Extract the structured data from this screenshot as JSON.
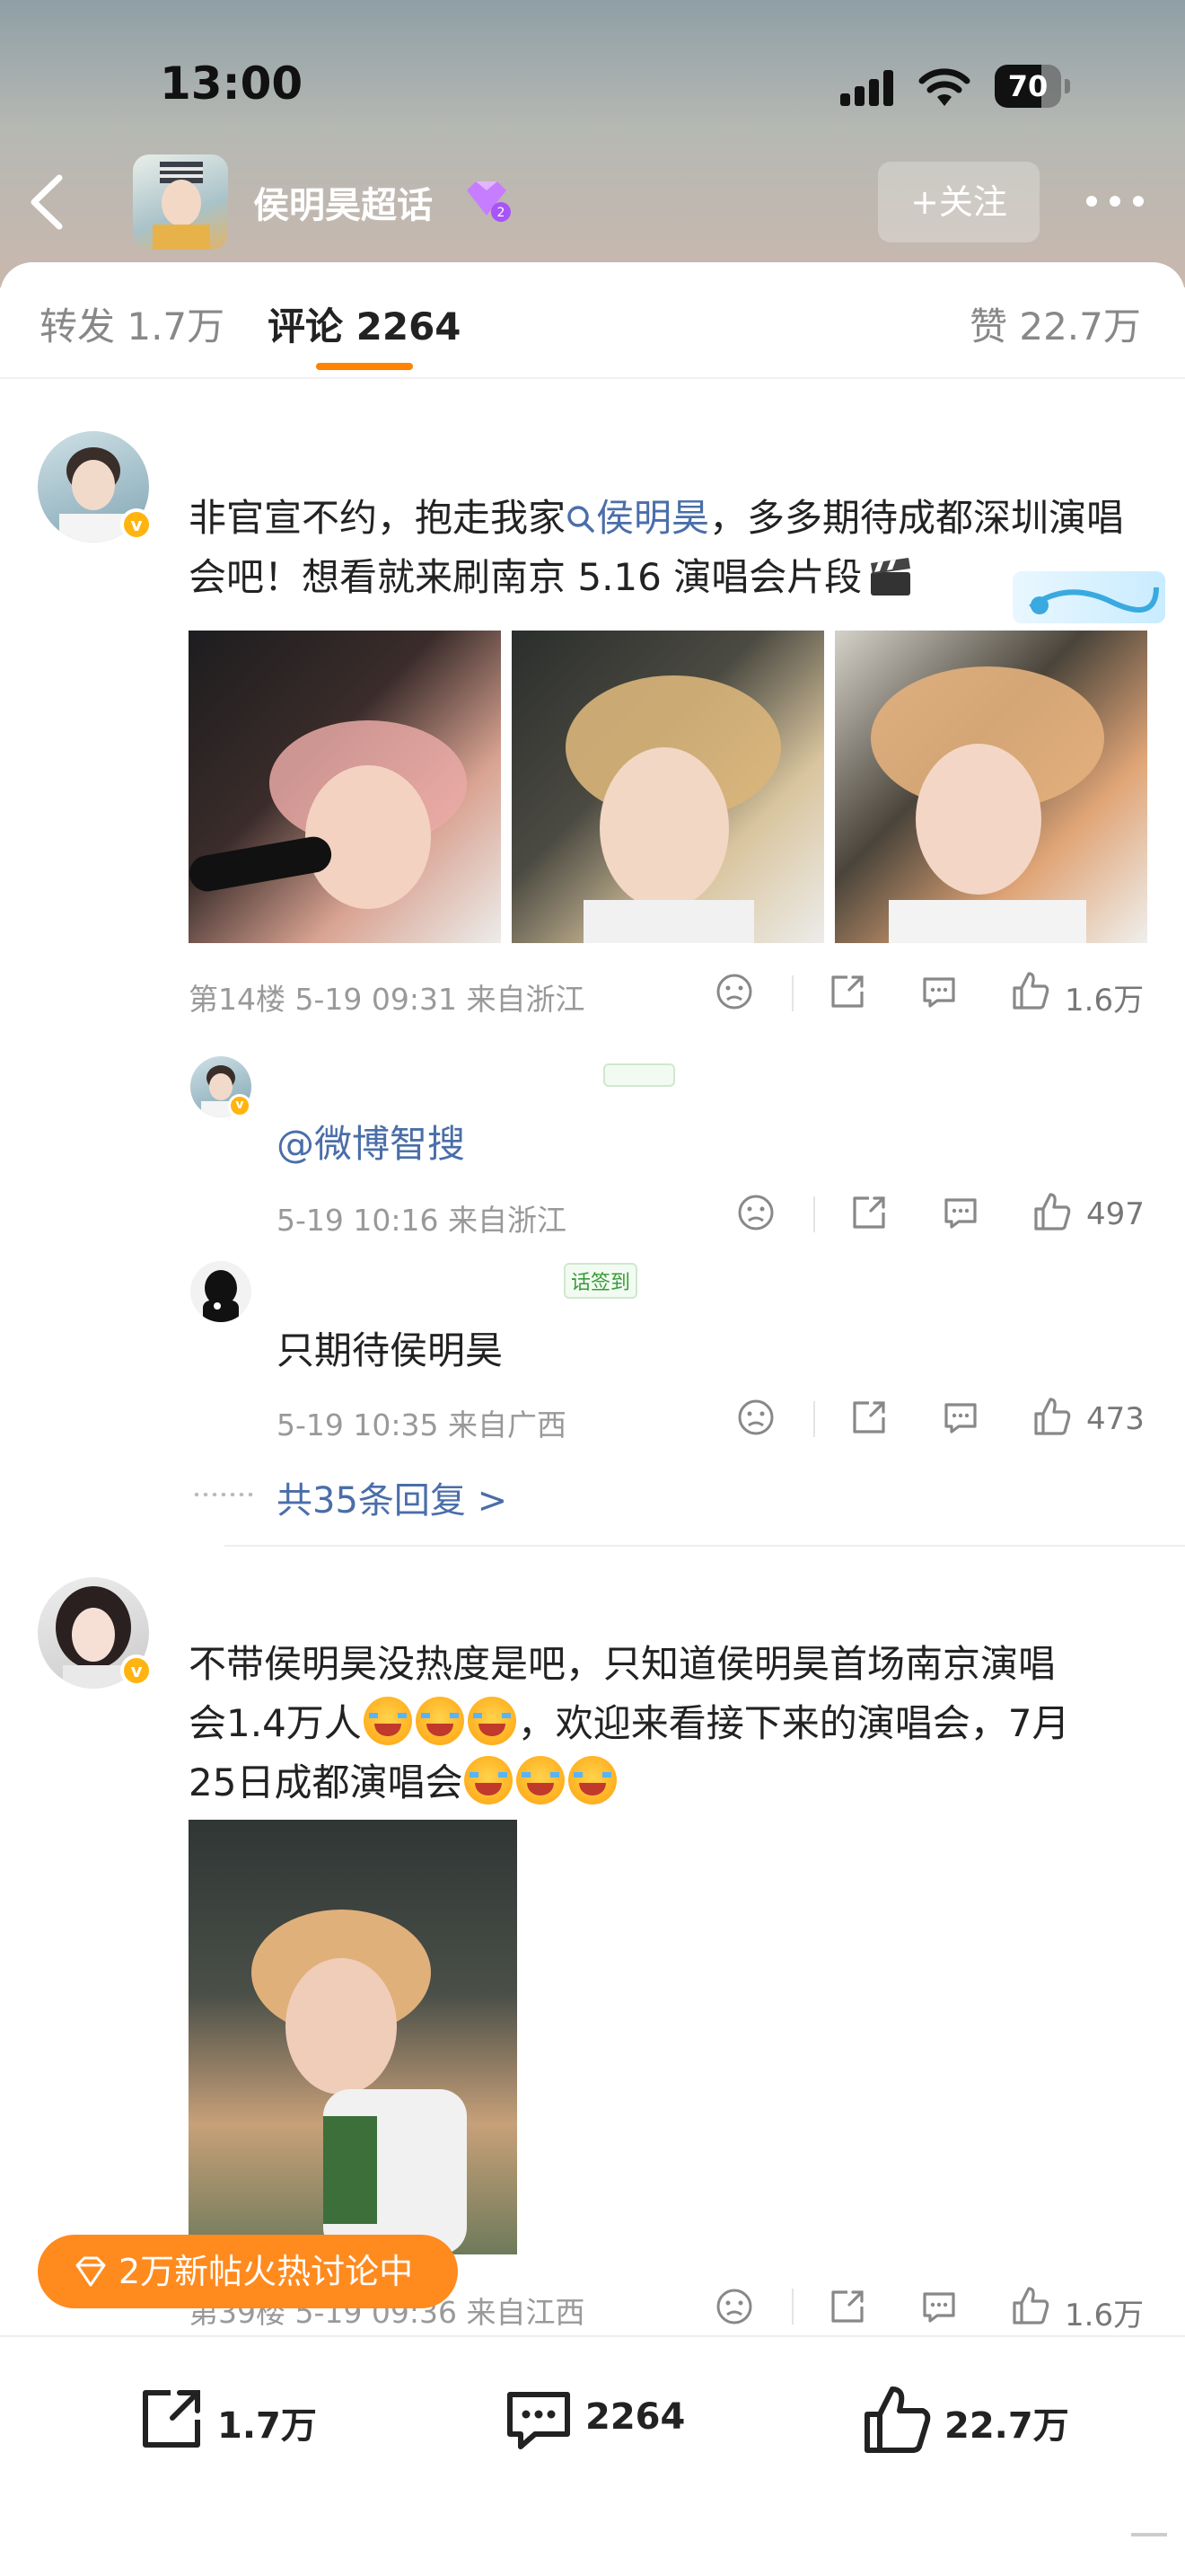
{
  "status_bar": {
    "time": "13:00",
    "battery": "70",
    "battery_level": 0.7
  },
  "nav": {
    "title": "侯明昊超话",
    "follow_label": "+关注"
  },
  "tabs": {
    "repost": "转发 1.7万",
    "comment": "评论 2264",
    "like": "赞 22.7万"
  },
  "comment1": {
    "text_before": "非官宣不约，抱走我家",
    "mention": "侯明昊",
    "text_after": "，多多期待成都深圳演唱会吧！想看就来刷南京 5.16 演唱会片段",
    "meta": "第14楼 5-19 09:31 来自浙江",
    "likes": "1.6万"
  },
  "reply1": {
    "text": "@微博智搜",
    "meta": "5-19 10:16 来自浙江",
    "likes": "497"
  },
  "reply2": {
    "text": "只期待侯明昊",
    "tag": "话签到",
    "meta": "5-19 10:35 来自广西",
    "likes": "473"
  },
  "more_replies": "共35条回复 >",
  "comment2": {
    "line1": "不带侯明昊没热度是吧，只知道侯明昊首场南京演唱",
    "line2a": "会1.4万人",
    "line2b": "，欢迎来看接下来的演唱会，7月",
    "line3": "25日成都演唱会",
    "meta": "第39楼 5-19 09:36 来自江西",
    "likes": "1.6万"
  },
  "hot_pill": "2万新帖火热讨论中",
  "bottom_bar": {
    "repost": "1.7万",
    "comment": "2264",
    "like": "22.7万"
  },
  "colors": {
    "accent": "#ff8200",
    "link": "#4a6ea8",
    "pill": "#ff8a1e"
  }
}
